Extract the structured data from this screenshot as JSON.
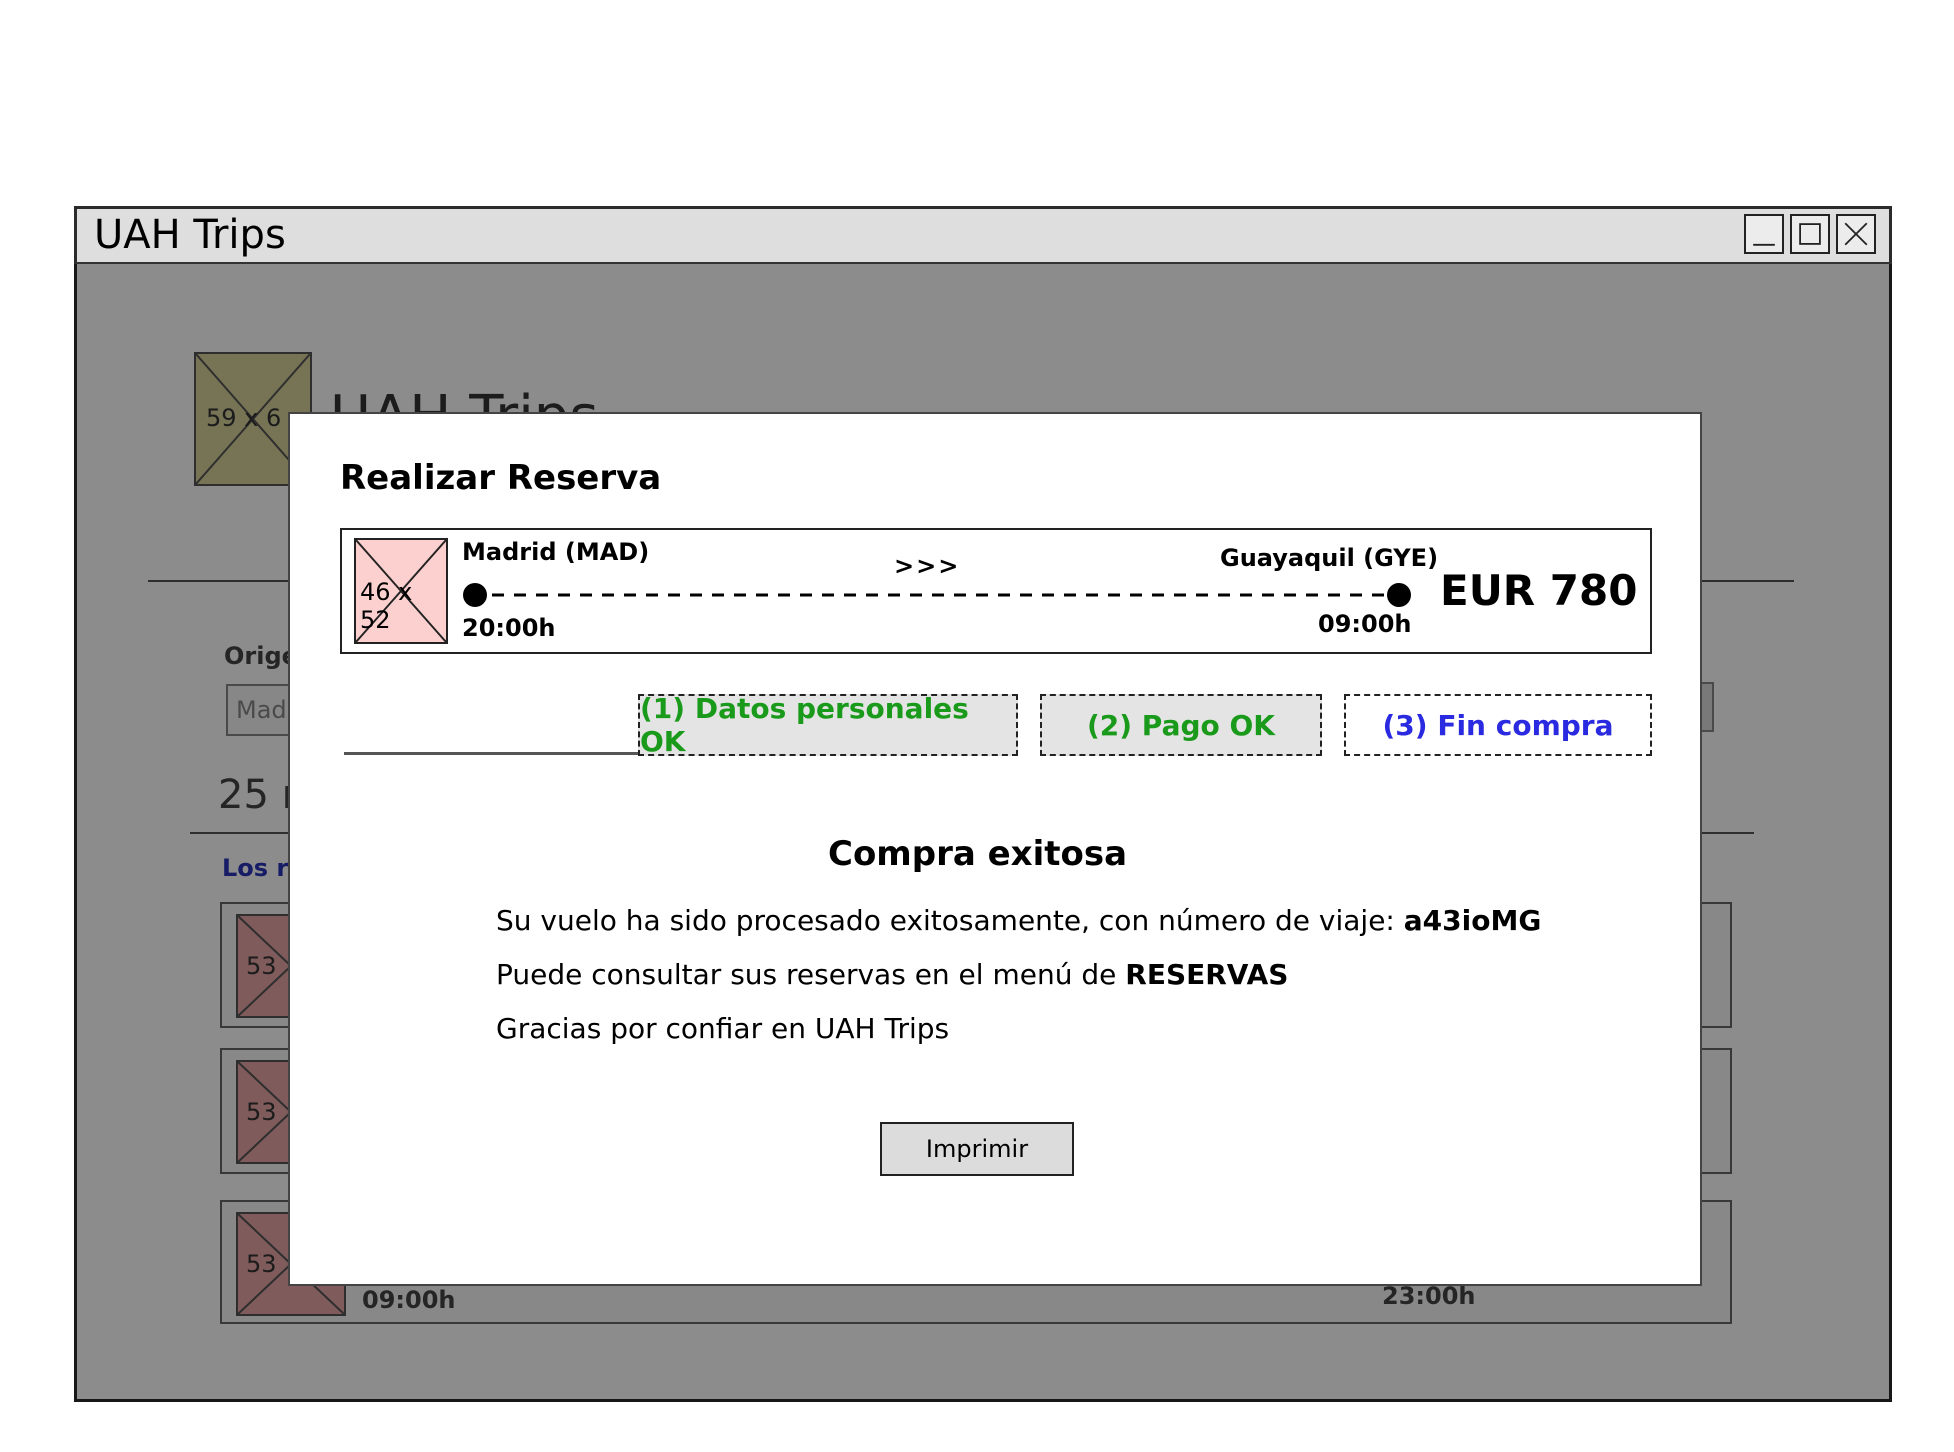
{
  "window": {
    "title": "UAH Trips",
    "controls": [
      "minimize",
      "maximize",
      "close"
    ]
  },
  "background": {
    "logo_placeholder": "59 x 6",
    "app_title": "UAH Trips",
    "origin_label": "Orige",
    "origin_value": "Mad",
    "results_count": "25 r",
    "results_label": "Los r",
    "cards": [
      {
        "thumb": "53",
        "dep_time": "",
        "arr_time": ""
      },
      {
        "thumb": "53",
        "dep_time": "",
        "arr_time": ""
      },
      {
        "thumb": "53",
        "dep_time": "09:00h",
        "arr_time": "23:00h"
      }
    ]
  },
  "modal": {
    "title": "Realizar Reserva",
    "flight": {
      "thumb": "46 x 52",
      "origin": "Madrid (MAD)",
      "destination": "Guayaquil (GYE)",
      "arrows": ">>>",
      "departure_time": "20:00h",
      "arrival_time": "09:00h",
      "price": "EUR 780"
    },
    "steps": [
      {
        "label": "(1) Datos personales OK",
        "state": "done",
        "color": "#1a9a1a"
      },
      {
        "label": "(2) Pago OK",
        "state": "done",
        "color": "#1a9a1a"
      },
      {
        "label": "(3) Fin compra",
        "state": "active",
        "color": "#2a2ae0"
      }
    ],
    "success_title": "Compra exitosa",
    "message1_prefix": "Su vuelo ha sido procesado exitosamente, con número de viaje: ",
    "trip_number": "a43ioMG",
    "message2_prefix": "Puede consultar sus reservas en el menú de ",
    "reservations_menu": "RESERVAS",
    "message3": "Gracias por confiar en UAH Trips",
    "print_button": "Imprimir"
  }
}
